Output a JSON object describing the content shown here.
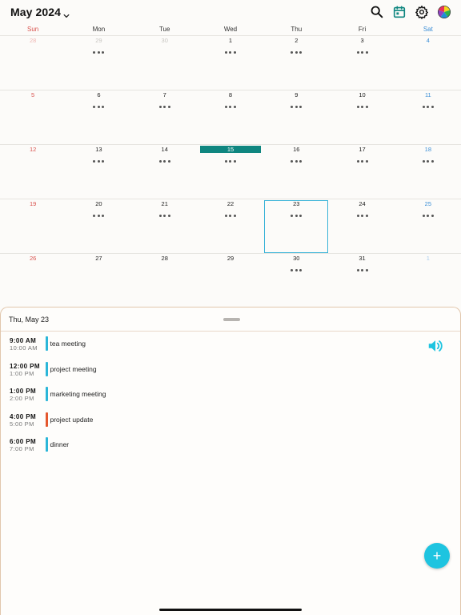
{
  "header": {
    "month_title": "May 2024",
    "actions": [
      "search-icon",
      "calendar-today-icon",
      "gear-icon",
      "color-wheel-icon"
    ]
  },
  "colors": {
    "today": "#0f8680",
    "selected_outline": "#3bb4d8",
    "sunday": "#d9534f",
    "saturday": "#3d8fd6",
    "fab": "#1ec4e0"
  },
  "weekdays": [
    "Sun",
    "Mon",
    "Tue",
    "Wed",
    "Thu",
    "Fri",
    "Sat"
  ],
  "weeks": [
    [
      {
        "day": "28",
        "other": true,
        "dots": false
      },
      {
        "day": "29",
        "other": true,
        "dots": true
      },
      {
        "day": "30",
        "other": true,
        "dots": false
      },
      {
        "day": "1",
        "dots": true
      },
      {
        "day": "2",
        "dots": true
      },
      {
        "day": "3",
        "dots": true
      },
      {
        "day": "4",
        "dots": false
      }
    ],
    [
      {
        "day": "5",
        "dots": false
      },
      {
        "day": "6",
        "dots": true
      },
      {
        "day": "7",
        "dots": true
      },
      {
        "day": "8",
        "dots": true
      },
      {
        "day": "9",
        "dots": true
      },
      {
        "day": "10",
        "dots": true
      },
      {
        "day": "11",
        "dots": true
      }
    ],
    [
      {
        "day": "12",
        "dots": false
      },
      {
        "day": "13",
        "dots": true
      },
      {
        "day": "14",
        "dots": true
      },
      {
        "day": "15",
        "dots": true,
        "today": true
      },
      {
        "day": "16",
        "dots": true
      },
      {
        "day": "17",
        "dots": true
      },
      {
        "day": "18",
        "dots": true
      }
    ],
    [
      {
        "day": "19",
        "dots": false
      },
      {
        "day": "20",
        "dots": true
      },
      {
        "day": "21",
        "dots": true
      },
      {
        "day": "22",
        "dots": true
      },
      {
        "day": "23",
        "dots": true,
        "selected": true
      },
      {
        "day": "24",
        "dots": true
      },
      {
        "day": "25",
        "dots": true
      }
    ],
    [
      {
        "day": "26",
        "dots": false
      },
      {
        "day": "27",
        "dots": false
      },
      {
        "day": "28",
        "dots": false
      },
      {
        "day": "29",
        "dots": false
      },
      {
        "day": "30",
        "dots": true
      },
      {
        "day": "31",
        "dots": true
      },
      {
        "day": "1",
        "other": true,
        "dots": false
      }
    ]
  ],
  "sheet": {
    "title": "Thu, May 23",
    "events": [
      {
        "start": "9:00 AM",
        "end": "10:00 AM",
        "title": "tea meeting",
        "color": "#2bb6d8"
      },
      {
        "start": "12:00 PM",
        "end": "1:00 PM",
        "title": "project meeting",
        "color": "#2bb6d8"
      },
      {
        "start": "1:00 PM",
        "end": "2:00 PM",
        "title": "marketing meeting",
        "color": "#2bb6d8"
      },
      {
        "start": "4:00 PM",
        "end": "5:00 PM",
        "title": "project update",
        "color": "#e4572e"
      },
      {
        "start": "6:00 PM",
        "end": "7:00 PM",
        "title": "dinner",
        "color": "#2bb6d8"
      }
    ]
  },
  "fab": {
    "label": "+",
    "icon": "plus-icon"
  }
}
